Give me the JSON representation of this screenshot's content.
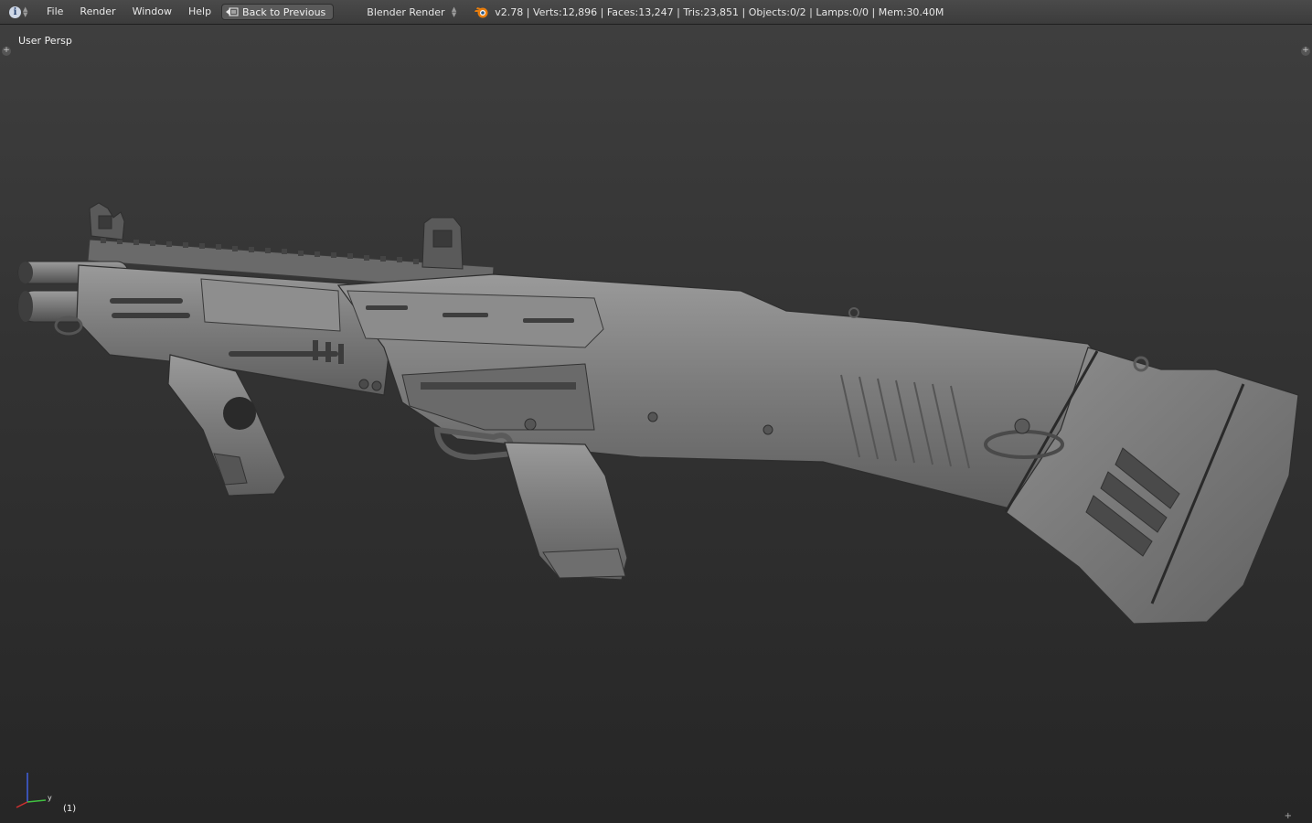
{
  "header": {
    "menus": [
      "File",
      "Render",
      "Window",
      "Help"
    ],
    "back_button": "Back to Previous",
    "render_engine": "Blender Render",
    "stats": "v2.78 | Verts:12,896 | Faces:13,247 | Tris:23,851 | Objects:0/2 | Lamps:0/0 | Mem:30.40M"
  },
  "viewport": {
    "view_name": "User Persp",
    "frame_label": "(1)",
    "axis_y_label": "y",
    "model": "shotgun-mesh"
  },
  "colors": {
    "header_bg": "#424242",
    "viewport_top": "#3e3e3e",
    "viewport_bottom": "#262626",
    "mesh_light": "#8a8a8a",
    "mesh_dark": "#5c5c5c",
    "axis_x": "#d03030",
    "axis_y": "#40c040",
    "axis_z": "#4060e0"
  }
}
